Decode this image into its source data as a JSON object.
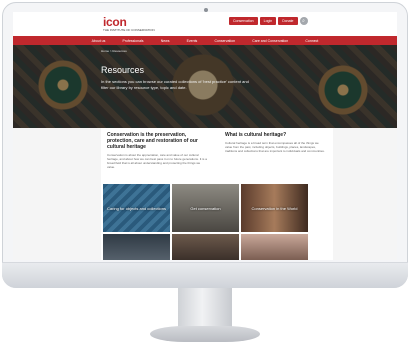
{
  "site": {
    "logo": "icon",
    "logo_sub": "THE INSTITUTE OF CONSERVATION",
    "header_buttons": [
      "Conservation",
      "Login",
      "Donate"
    ],
    "search_icon": "search-icon"
  },
  "nav": [
    "About us",
    "Professionals",
    "News",
    "Events",
    "Conservation",
    "Care and Conservation",
    "Connect"
  ],
  "hero": {
    "breadcrumb": "Home > Resources",
    "title": "Resources",
    "description": "In the sections you can browse our curated collections of 'best practice' content and filter our library by resource type, topic and date."
  },
  "intro": {
    "left_title": "Conservation is the preservation, protection, care and restoration of our cultural heritage",
    "left_text": "Conservation is about the appreciation, care and value of our cultural heritage, and about how we can best pass it on to future generations. It is a broad field that is all about understanding and protecting the things we value.",
    "right_title": "What is cultural heritage?",
    "right_text": "Cultural heritage is a broad term that encompasses all of the things we value from the past, including objects, buildings, places, landscapes, traditions and collections that are important to individuals and communities."
  },
  "tiles": [
    {
      "label": "Caring for objects and collections"
    },
    {
      "label": "Get conservation"
    },
    {
      "label": "Conservation in the World"
    },
    {
      "label": ""
    },
    {
      "label": ""
    },
    {
      "label": ""
    }
  ]
}
